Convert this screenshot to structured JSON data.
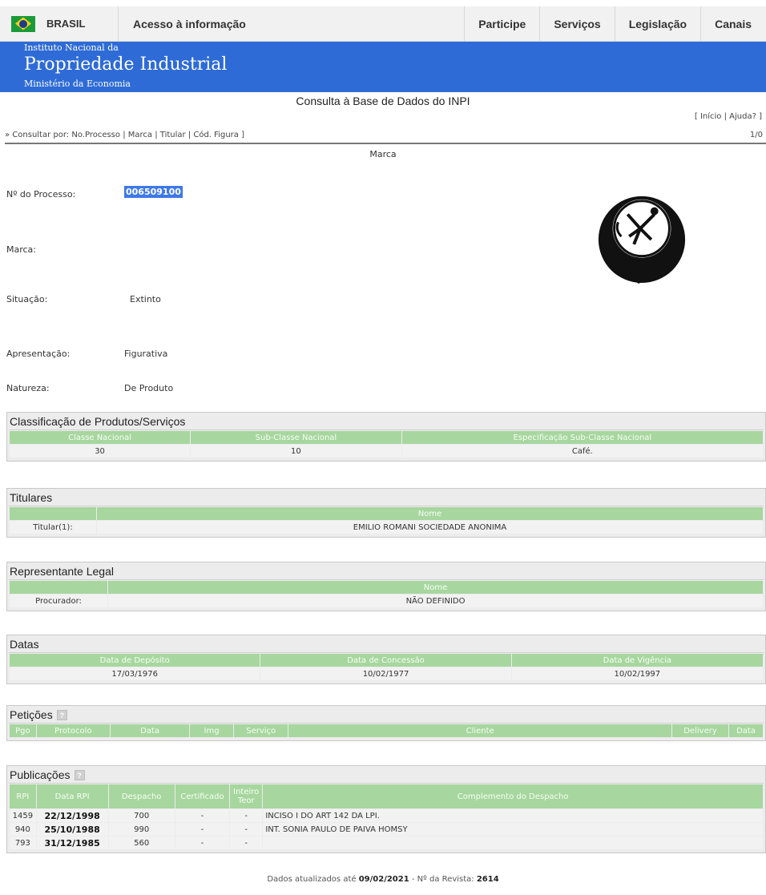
{
  "govbar": {
    "brasil": "BRASIL",
    "access": "Acesso à informação",
    "links": [
      "Participe",
      "Serviços",
      "Legislação",
      "Canais"
    ],
    "flag_colors": {
      "green": "#1b9a3a",
      "yellow": "#f7d117",
      "blue": "#1d3c8f"
    }
  },
  "banner": {
    "line1": "Instituto Nacional da",
    "line2": "Propriedade Industrial",
    "line3": "Ministério da Economia",
    "color": "#2e6bd6"
  },
  "page_title": "Consulta à Base de Dados do INPI",
  "toplinks": {
    "open": "[ ",
    "inicio": "Início",
    "sep": " | ",
    "ajuda": "Ajuda?",
    "close": " ]"
  },
  "consult": {
    "prefix": "» Consultar por: ",
    "links": [
      "No.Processo",
      "Marca",
      "Titular",
      "Cód. Figura"
    ],
    "sep": " | ",
    "close": " ]"
  },
  "pagecount": "1/0",
  "section_label": "Marca",
  "fields": {
    "processo_label": "Nº do Processo:",
    "processo_value": "006509100",
    "marca_label": "Marca:",
    "situacao_label": "Situação:",
    "situacao_value": "Extinto",
    "apresentacao_label": "Apresentação:",
    "apresentacao_value": "Figurativa",
    "natureza_label": "Natureza:",
    "natureza_value": "De Produto"
  },
  "classificacao": {
    "title": "Classificação de Produtos/Serviços",
    "headers": [
      "Classe Nacional",
      "Sub-Classe Nacional",
      "Especificação Sub-Classe Nacional"
    ],
    "row": [
      "30",
      "10",
      "Café."
    ]
  },
  "titulares": {
    "title": "Titulares",
    "header": "Nome",
    "row_label": "Titular(1):",
    "row_value": "EMILIO ROMANI SOCIEDADE ANONIMA"
  },
  "representante": {
    "title": "Representante Legal",
    "header": "Nome",
    "row_label": "Procurador:",
    "row_value": "NÃO DEFINIDO"
  },
  "datas": {
    "title": "Datas",
    "headers": [
      "Data de Depósito",
      "Data de Concessão",
      "Data de Vigência"
    ],
    "row": [
      "17/03/1976",
      "10/02/1977",
      "10/02/1997"
    ]
  },
  "peticoes": {
    "title": "Petições",
    "headers": [
      "Pgo",
      "Protocolo",
      "Data",
      "Img",
      "Serviço",
      "Cliente",
      "Delivery",
      "Data"
    ]
  },
  "publicacoes": {
    "title": "Publicações",
    "headers": [
      "RPI",
      "Data RPI",
      "Despacho",
      "Certificado",
      "Inteiro Teor",
      "Complemento do Despacho"
    ],
    "rows": [
      {
        "rpi": "1459",
        "data": "22/12/1998",
        "despacho": "700",
        "certificado": "-",
        "inteiro": "-",
        "complemento": "INCISO I DO ART 142 DA LPI."
      },
      {
        "rpi": "940",
        "data": "25/10/1988",
        "despacho": "990",
        "certificado": "-",
        "inteiro": "-",
        "complemento": "INT. SONIA PAULO DE PAIVA HOMSY"
      },
      {
        "rpi": "793",
        "data": "31/12/1985",
        "despacho": "560",
        "certificado": "-",
        "inteiro": "-",
        "complemento": ""
      }
    ]
  },
  "footer": {
    "prefix": "Dados atualizados até ",
    "date": "09/02/2021",
    "mid": " - Nº da Revista: ",
    "revista": "2614"
  }
}
